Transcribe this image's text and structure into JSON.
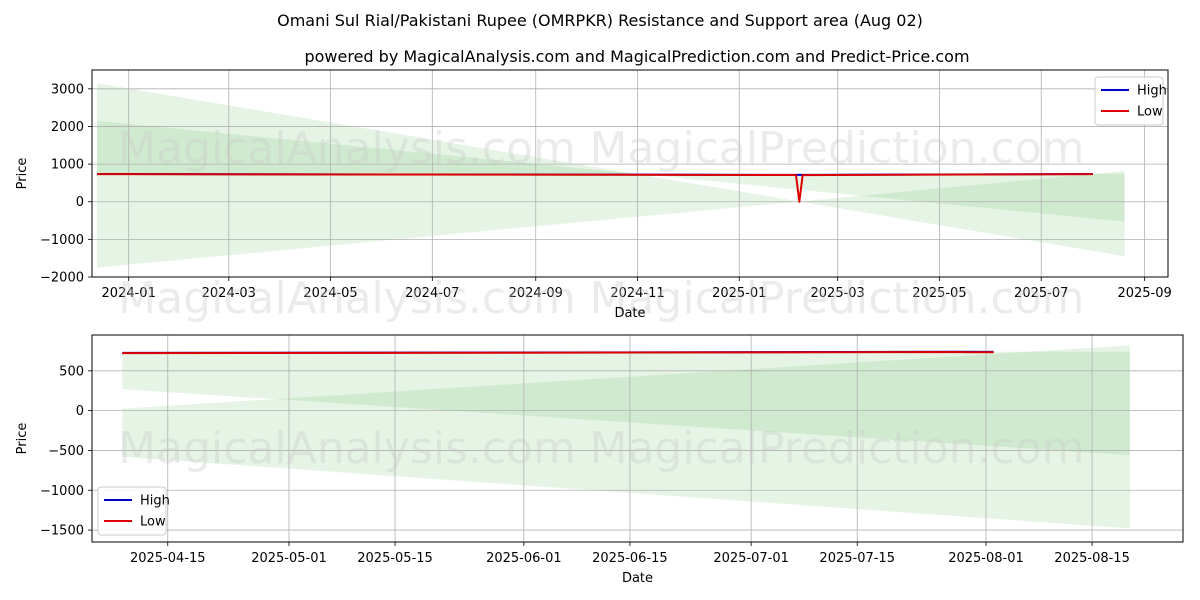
{
  "title": "Omani Sul Rial/Pakistani Rupee (OMRPKR) Resistance and Support area (Aug 02)",
  "subtitle": "powered by MagicalAnalysis.com and MagicalPrediction.com and Predict-Price.com",
  "watermark": [
    "MagicalAnalysis.com",
    "MagicalPrediction.com"
  ],
  "colors": {
    "high": "#0000cc",
    "low": "#dd0000",
    "band": "#4caf50",
    "grid": "#b0b0b0"
  },
  "chart_data": [
    {
      "type": "line",
      "xlabel": "Date",
      "ylabel": "Price",
      "xlim": [
        "2023-12-10",
        "2025-09-15"
      ],
      "ylim": [
        -2000,
        3500
      ],
      "x_ticks": [
        "2024-01",
        "2024-03",
        "2024-05",
        "2024-07",
        "2024-09",
        "2024-11",
        "2025-01",
        "2025-03",
        "2025-05",
        "2025-07",
        "2025-09"
      ],
      "x_tick_dates": [
        "2024-01-01",
        "2024-03-01",
        "2024-05-01",
        "2024-07-01",
        "2024-09-01",
        "2024-11-01",
        "2025-01-01",
        "2025-03-01",
        "2025-05-01",
        "2025-07-01",
        "2025-09-01"
      ],
      "y_ticks": [
        -2000,
        -1000,
        0,
        1000,
        2000,
        3000
      ],
      "grid": true,
      "legend": {
        "position": "top-right",
        "entries": [
          "High",
          "Low"
        ]
      },
      "bands": [
        {
          "x": [
            "2023-12-13",
            "2025-08-20"
          ],
          "upper": [
            3150,
            -1450
          ],
          "lower": [
            -1750,
            820
          ]
        },
        {
          "x": [
            "2023-12-13",
            "2025-08-20"
          ],
          "upper": [
            2150,
            -530
          ],
          "lower": [
            700,
            740
          ]
        }
      ],
      "series": [
        {
          "name": "High",
          "x": [
            "2023-12-13",
            "2024-06-01",
            "2024-11-01",
            "2025-02-05",
            "2025-02-06",
            "2025-02-07",
            "2025-08-01"
          ],
          "y": [
            738,
            725,
            720,
            712,
            712,
            712,
            738
          ]
        },
        {
          "name": "Low",
          "x": [
            "2023-12-13",
            "2024-06-01",
            "2024-11-01",
            "2025-02-04",
            "2025-02-06",
            "2025-02-08",
            "2025-08-01"
          ],
          "y": [
            735,
            722,
            716,
            710,
            0,
            708,
            735
          ]
        }
      ]
    },
    {
      "type": "line",
      "xlabel": "Date",
      "ylabel": "Price",
      "xlim": [
        "2025-04-05",
        "2025-08-27"
      ],
      "ylim": [
        -1650,
        950
      ],
      "x_ticks": [
        "2025-04-15",
        "2025-05-01",
        "2025-05-15",
        "2025-06-01",
        "2025-06-15",
        "2025-07-01",
        "2025-07-15",
        "2025-08-01",
        "2025-08-15"
      ],
      "y_ticks": [
        -1500,
        -1000,
        -500,
        0,
        500
      ],
      "grid": true,
      "legend": {
        "position": "bottom-left",
        "entries": [
          "High",
          "Low"
        ]
      },
      "bands": [
        {
          "x": [
            "2025-04-09",
            "2025-08-20"
          ],
          "upper": [
            25,
            820
          ],
          "lower": [
            -580,
            -1480
          ]
        },
        {
          "x": [
            "2025-04-09",
            "2025-08-20"
          ],
          "upper": [
            740,
            740
          ],
          "lower": [
            270,
            -560
          ]
        }
      ],
      "series": [
        {
          "name": "High",
          "x": [
            "2025-04-09",
            "2025-06-01",
            "2025-07-01",
            "2025-07-28",
            "2025-08-02"
          ],
          "y": [
            726,
            730,
            735,
            740,
            738
          ]
        },
        {
          "name": "Low",
          "x": [
            "2025-04-09",
            "2025-06-01",
            "2025-07-01",
            "2025-07-28",
            "2025-07-30",
            "2025-08-02"
          ],
          "y": [
            722,
            727,
            732,
            737,
            733,
            734
          ]
        }
      ]
    }
  ]
}
